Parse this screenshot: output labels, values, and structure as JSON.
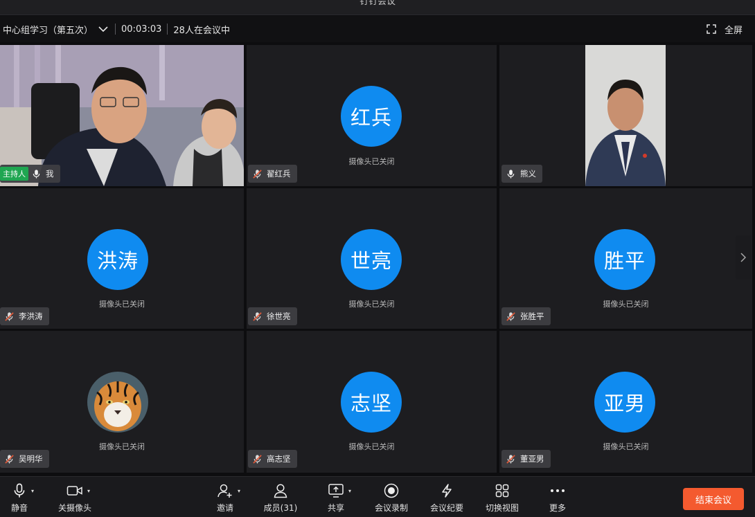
{
  "window": {
    "title": "钉钉会议"
  },
  "infobar": {
    "meeting_name": "中心组学习（第五次）",
    "duration": "00:03:03",
    "participants_in_meeting": "28人在会议中",
    "fullscreen_label": "全屏"
  },
  "tiles": [
    {
      "name": "我",
      "role": "主持人",
      "mic": "on",
      "video": true
    },
    {
      "name": "翟红兵",
      "avatar_text": "红兵",
      "camera_status": "摄像头已关闭",
      "mic": "muted"
    },
    {
      "name": "熊义",
      "mic": "on",
      "video": true
    },
    {
      "name": "李洪涛",
      "avatar_text": "洪涛",
      "camera_status": "摄像头已关闭",
      "mic": "muted"
    },
    {
      "name": "徐世亮",
      "avatar_text": "世亮",
      "camera_status": "摄像头已关闭",
      "mic": "muted"
    },
    {
      "name": "张胜平",
      "avatar_text": "胜平",
      "camera_status": "摄像头已关闭",
      "mic": "muted"
    },
    {
      "name": "吴明华",
      "avatar_image": "tiger-photo",
      "camera_status": "摄像头已关闭",
      "mic": "muted"
    },
    {
      "name": "高志坚",
      "avatar_text": "志坚",
      "camera_status": "摄像头已关闭",
      "mic": "muted"
    },
    {
      "name": "董亚男",
      "avatar_text": "亚男",
      "camera_status": "摄像头已关闭",
      "mic": "muted"
    }
  ],
  "toolbar": {
    "mute": "静音",
    "camera_off": "关摄像头",
    "invite": "邀请",
    "members": "成员(31)",
    "share": "共享",
    "record": "会议录制",
    "minutes": "会议纪要",
    "switch_view": "切换视图",
    "more": "更多",
    "end_meeting": "结束会议"
  },
  "colors": {
    "accent": "#0f8bf0",
    "host_badge": "#1fa651",
    "end_button": "#f45a2f",
    "muted_icon": "#e05a3a"
  }
}
